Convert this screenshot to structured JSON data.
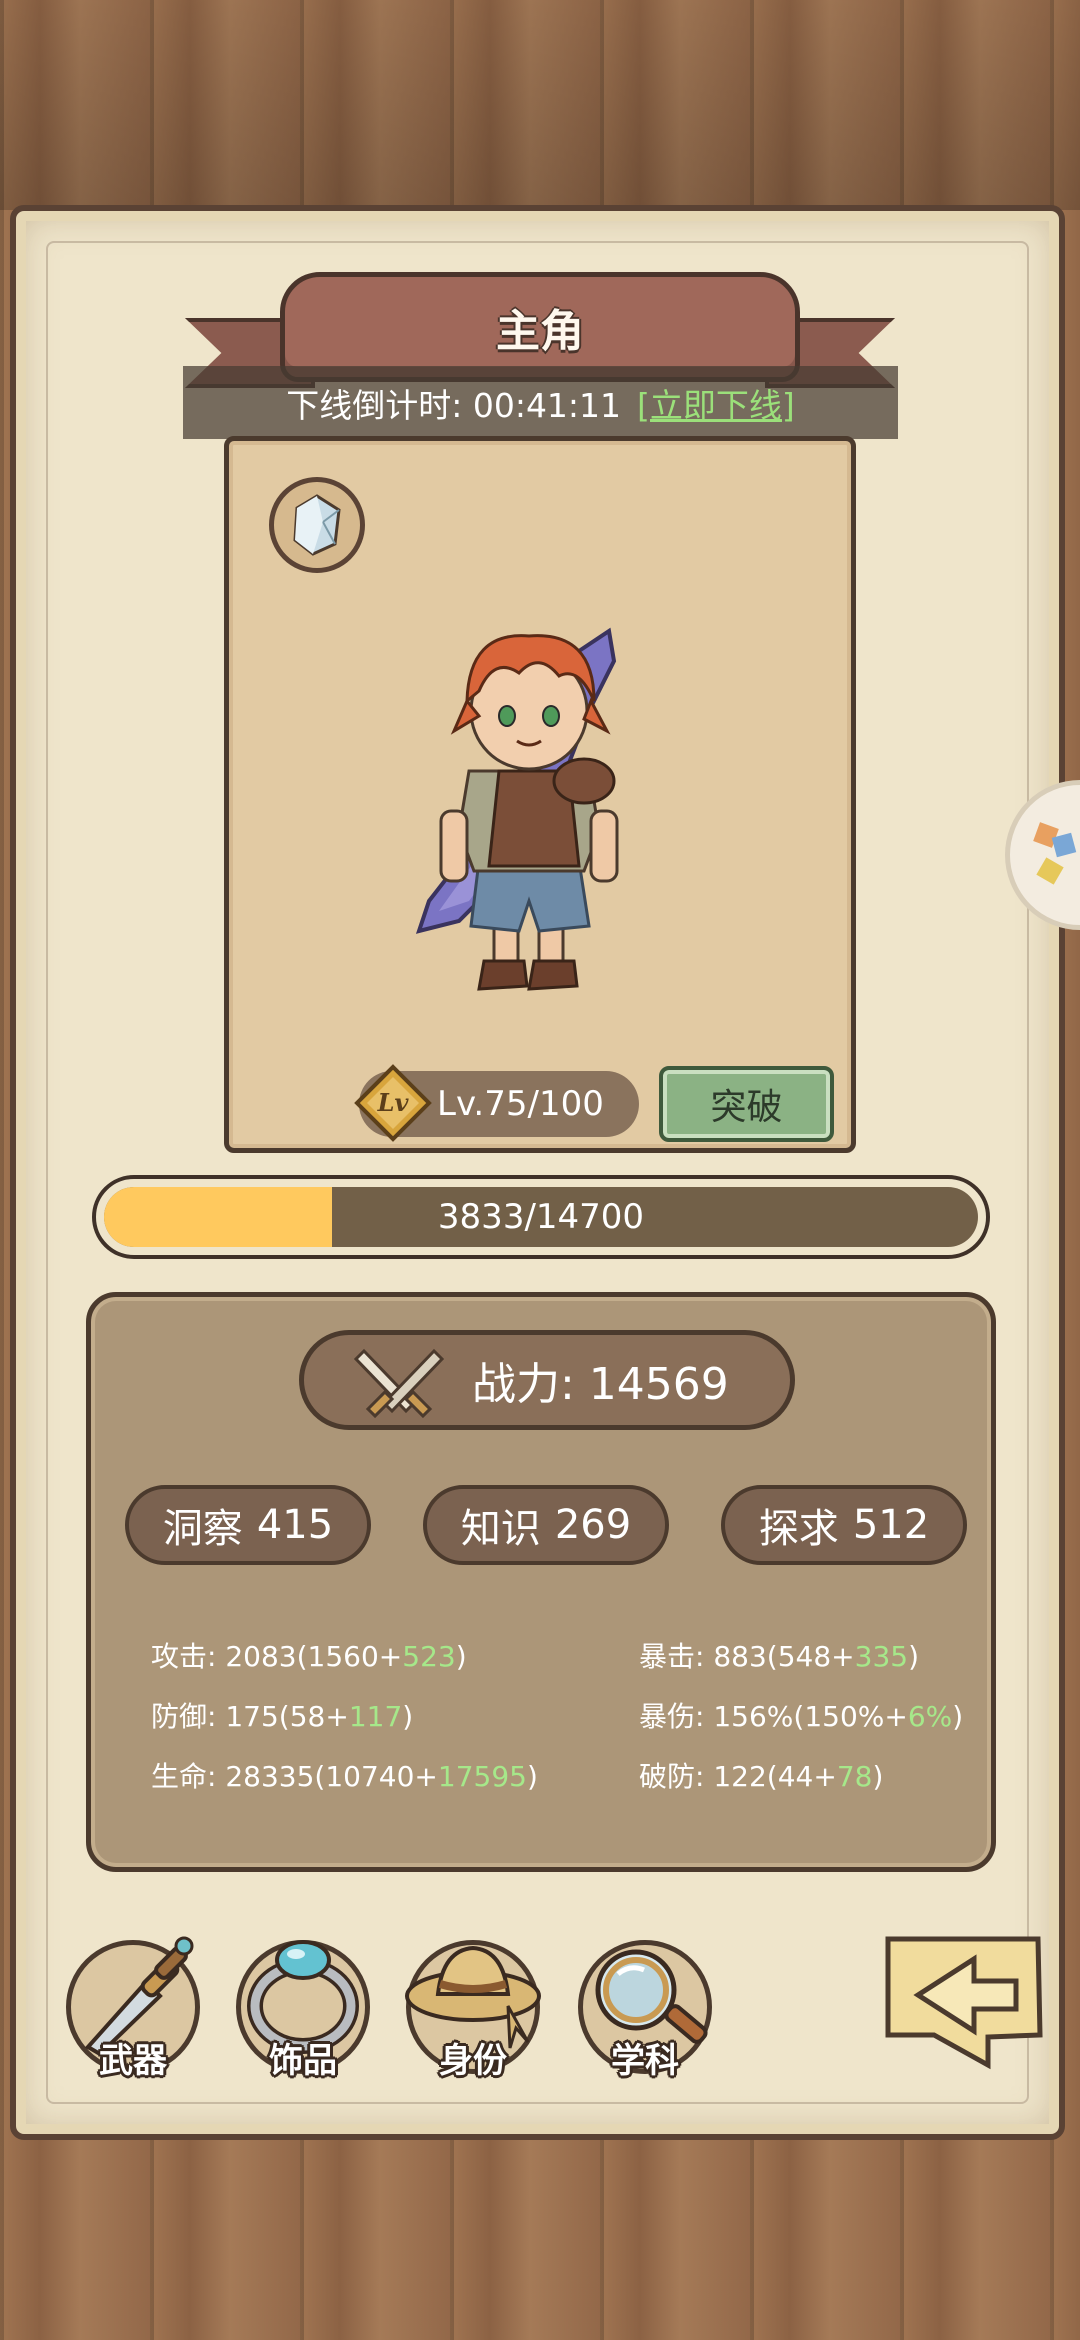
{
  "header": {
    "title": "主角",
    "offline_label": "下线倒计时:",
    "offline_time": "00:41:11",
    "offline_action": "[立即下线]"
  },
  "character": {
    "gem_icon": "crystal-gem-icon",
    "level_text": "Lv.75/100",
    "level_badge": "Lv",
    "breakthrough_label": "突破"
  },
  "experience": {
    "current": 3833,
    "max": 14700,
    "text": "3833/14700"
  },
  "stats": {
    "power_label": "战力: 14569",
    "attributes": [
      {
        "name": "洞察",
        "value": "415"
      },
      {
        "name": "知识",
        "value": "269"
      },
      {
        "name": "探求",
        "value": "512"
      }
    ],
    "left": [
      {
        "label": "攻击: ",
        "total": "2083",
        "base": "(1560+",
        "bonus": "523",
        "close": ")"
      },
      {
        "label": "防御: ",
        "total": "175",
        "base": "(58+",
        "bonus": "117",
        "close": ")"
      },
      {
        "label": "生命: ",
        "total": "28335",
        "base": "(10740+",
        "bonus": "17595",
        "close": ")"
      }
    ],
    "right": [
      {
        "label": "暴击: ",
        "total": "883",
        "base": "(548+",
        "bonus": "335",
        "close": ")"
      },
      {
        "label": "暴伤: ",
        "total": "156%",
        "base": "(150%+",
        "bonus": "6%",
        "close": ")"
      },
      {
        "label": "破防: ",
        "total": "122",
        "base": "(44+",
        "bonus": "78",
        "close": ")"
      }
    ]
  },
  "nav": {
    "items": [
      {
        "label": "武器",
        "icon": "dagger-icon"
      },
      {
        "label": "饰品",
        "icon": "ring-icon"
      },
      {
        "label": "身份",
        "icon": "straw-hat-icon"
      },
      {
        "label": "学科",
        "icon": "magnifier-icon"
      }
    ],
    "back_icon": "back-arrow-icon"
  },
  "colors": {
    "exp_fill": "#ffc95e",
    "bonus_green": "#a6e88a",
    "breakthrough_green": "#8bb284",
    "offline_link": "#9be07a"
  }
}
